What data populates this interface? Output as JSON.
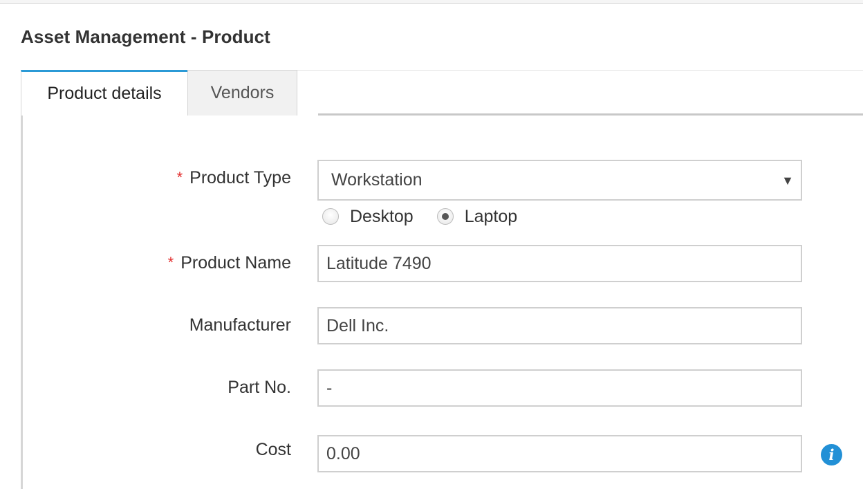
{
  "header": {
    "title": "Asset Management - Product"
  },
  "tabs": [
    {
      "label": "Product details",
      "active": true
    },
    {
      "label": "Vendors",
      "active": false
    }
  ],
  "form": {
    "product_type": {
      "label": "Product Type",
      "required_marker": "*",
      "selected": "Workstation",
      "radio_options": [
        "Desktop",
        "Laptop"
      ],
      "radio_selected": "Laptop"
    },
    "product_name": {
      "label": "Product Name",
      "required_marker": "*",
      "value": "Latitude 7490"
    },
    "manufacturer": {
      "label": "Manufacturer",
      "value": "Dell Inc."
    },
    "part_no": {
      "label": "Part No.",
      "value": "-"
    },
    "cost": {
      "label": "Cost",
      "value": "0.00"
    }
  },
  "icons": {
    "dropdown_arrow": "▼",
    "info": "i"
  },
  "colors": {
    "accent": "#2b9ad6",
    "required": "#e22b2b",
    "info_icon": "#2290d6"
  }
}
